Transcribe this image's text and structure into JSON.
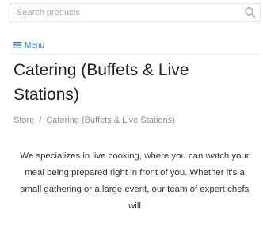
{
  "search": {
    "placeholder": "Search products"
  },
  "nav": {
    "menu_label": "Menu"
  },
  "page": {
    "title": "Catering (Buffets & Live Stations)",
    "description": "We specializes in live cooking, where you can watch your meal being prepared right in front of you. Whether it's a small gathering or a large event, our team of expert chefs will"
  },
  "breadcrumb": {
    "items": [
      {
        "label": "Store"
      },
      {
        "label": "Catering (Buffets & Live Stations)"
      }
    ],
    "separator": "/"
  },
  "icons": {
    "search": "search-icon",
    "menu": "hamburger-menu-icon"
  },
  "colors": {
    "link": "#2b7fd4",
    "muted_text": "#8e8e8e",
    "border": "#e3e3e3"
  }
}
